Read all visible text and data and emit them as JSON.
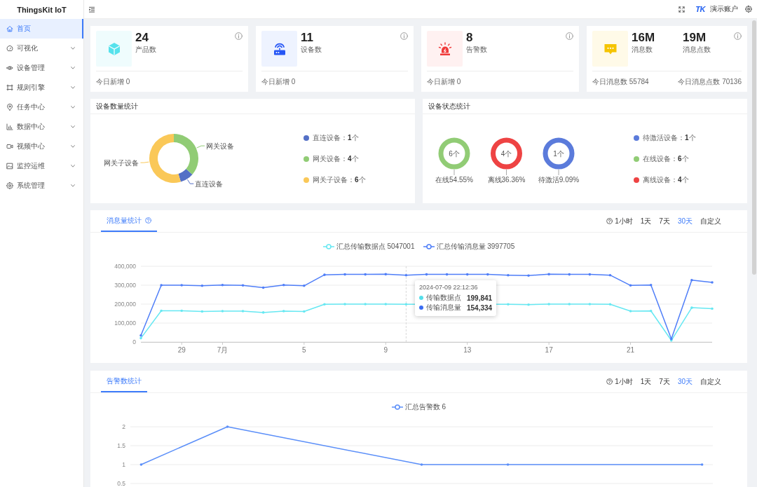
{
  "sidebar": {
    "logo": "ThingsKit IoT",
    "items": [
      {
        "label": "首页",
        "kind": "page",
        "selected": true
      },
      {
        "label": "可视化",
        "kind": "group",
        "selected": false
      },
      {
        "label": "设备管理",
        "kind": "group",
        "selected": false
      },
      {
        "label": "规则引擎",
        "kind": "group",
        "selected": false
      },
      {
        "label": "任务中心",
        "kind": "group",
        "selected": false
      },
      {
        "label": "数据中心",
        "kind": "group",
        "selected": false
      },
      {
        "label": "视频中心",
        "kind": "group",
        "selected": false
      },
      {
        "label": "监控运维",
        "kind": "group",
        "selected": false
      },
      {
        "label": "系统管理",
        "kind": "group",
        "selected": false
      }
    ]
  },
  "header": {
    "logo": "TK",
    "account": "演示账户"
  },
  "stat_cards": [
    {
      "kind": "product",
      "stats": [
        {
          "value": "24",
          "label": "产品数"
        }
      ],
      "footer": [
        "今日新增 0"
      ]
    },
    {
      "kind": "device",
      "stats": [
        {
          "value": "11",
          "label": "设备数"
        }
      ],
      "footer": [
        "今日新增 0"
      ]
    },
    {
      "kind": "alarm",
      "stats": [
        {
          "value": "8",
          "label": "告警数"
        }
      ],
      "footer": [
        "今日新增 0"
      ]
    },
    {
      "kind": "message",
      "stats": [
        {
          "value": "16M",
          "label": "消息数"
        },
        {
          "value": "19M",
          "label": "消息点数"
        }
      ],
      "footer": [
        "今日消息数 55784",
        "今日消息点数 70136"
      ]
    }
  ],
  "device_count": {
    "title": "设备数量统计",
    "chart_data": {
      "type": "donut",
      "categories": [
        "直连设备",
        "网关设备",
        "网关子设备"
      ],
      "values": [
        9.09,
        36.36,
        54.55
      ]
    },
    "legend": [
      {
        "text": "直连设备：**1**个",
        "color": "#5470c6"
      },
      {
        "text": "网关设备：**4**个",
        "color": "#91cc75"
      },
      {
        "text": "网关子设备：**6**个",
        "color": "#fac858"
      }
    ]
  },
  "device_status": {
    "title": "设备状态统计",
    "rings": [
      {
        "value": "6个",
        "label": "在线54.55%",
        "color": "#91cc75"
      },
      {
        "value": "4个",
        "label": "离线36.36%",
        "color": "#ee4343"
      },
      {
        "value": "1个",
        "label": "待激活9.09%",
        "color": "#5b7bdb"
      }
    ],
    "legend": [
      {
        "text": "待激活设备：**1**个",
        "color": "#5b7bdb"
      },
      {
        "text": "在线设备：**6**个",
        "color": "#91cc75"
      },
      {
        "text": "离线设备：**4**个",
        "color": "#ee4343"
      }
    ]
  },
  "message_stats": {
    "tabs": [
      {
        "label": "消息量统计",
        "help": true,
        "selected": true
      }
    ],
    "ranges": [
      {
        "label": "1小时",
        "selected": false
      },
      {
        "label": "1天",
        "selected": false
      },
      {
        "label": "7天",
        "selected": false
      },
      {
        "label": "30天",
        "selected": true
      },
      {
        "label": "自定义",
        "selected": false
      }
    ],
    "chart_data": {
      "type": "line",
      "categories": [
        null,
        null,
        "29",
        null,
        "7月",
        null,
        null,
        null,
        "5",
        null,
        null,
        null,
        "9",
        null,
        null,
        null,
        "13",
        null,
        null,
        null,
        "17",
        null,
        null,
        null,
        "21",
        null,
        null,
        null,
        null
      ],
      "ylim": [
        0,
        400000
      ],
      "yticks": [
        0,
        {
          "value": 100000,
          "label": "100,000"
        },
        {
          "value": 200000,
          "label": "200,000"
        },
        {
          "value": 300000,
          "label": "300,000"
        },
        {
          "value": 400000,
          "label": "400,000"
        }
      ],
      "grid": true,
      "series": [
        {
          "name": "汇总传输数据点 5047001",
          "color": "#66e8f2",
          "values": [
            20000,
            165000,
            165000,
            161000,
            163000,
            163000,
            156000,
            163000,
            161000,
            199000,
            200000,
            200000,
            200000,
            199000,
            null,
            null,
            null,
            null,
            199000,
            197000,
            200000,
            200000,
            200000,
            199000,
            163000,
            164000,
            8000,
            181000,
            176000
          ]
        },
        {
          "name": "汇总传输消息量 3997705",
          "color": "#4f7ef8",
          "values": [
            34000,
            300000,
            300000,
            297000,
            301000,
            299000,
            287000,
            301000,
            297000,
            355000,
            357000,
            357000,
            358000,
            353000,
            357000,
            357000,
            357000,
            357000,
            353000,
            351000,
            358000,
            357000,
            357000,
            353000,
            299000,
            301000,
            16000,
            327000,
            315000
          ]
        }
      ]
    },
    "tooltip": {
      "title": "2024-07-09 22:12:36",
      "rows": [
        {
          "label": "传输数据点",
          "value": "199,841",
          "color": "#56dfea"
        },
        {
          "label": "传输消息量",
          "value": "154,334",
          "color": "#3b6df2"
        }
      ]
    }
  },
  "alarm_stats": {
    "tabs": [
      {
        "label": "告警数统计",
        "help": false,
        "selected": true
      }
    ],
    "ranges": [
      {
        "label": "1小时",
        "selected": false
      },
      {
        "label": "1天",
        "selected": false
      },
      {
        "label": "7天",
        "selected": false
      },
      {
        "label": "30天",
        "selected": true
      },
      {
        "label": "自定义",
        "selected": false
      }
    ],
    "chart_data": {
      "type": "line",
      "categories": [
        null,
        null,
        null,
        null,
        null,
        null,
        null,
        null,
        null,
        null,
        null,
        null,
        null,
        null,
        null,
        null,
        null,
        null,
        null,
        null,
        null,
        null,
        null,
        null,
        null,
        null,
        null
      ],
      "ylim": [
        0.5,
        2
      ],
      "yticks": [
        0.5,
        1,
        1.5,
        2
      ],
      "grid": true,
      "series": [
        {
          "name": "汇总告警数 6",
          "color": "#5b8ff9",
          "values": [
            1,
            null,
            null,
            null,
            2,
            null,
            null,
            null,
            null,
            null,
            null,
            null,
            null,
            1,
            null,
            null,
            null,
            1,
            null,
            null,
            null,
            null,
            null,
            null,
            null,
            null,
            1
          ]
        }
      ]
    }
  }
}
